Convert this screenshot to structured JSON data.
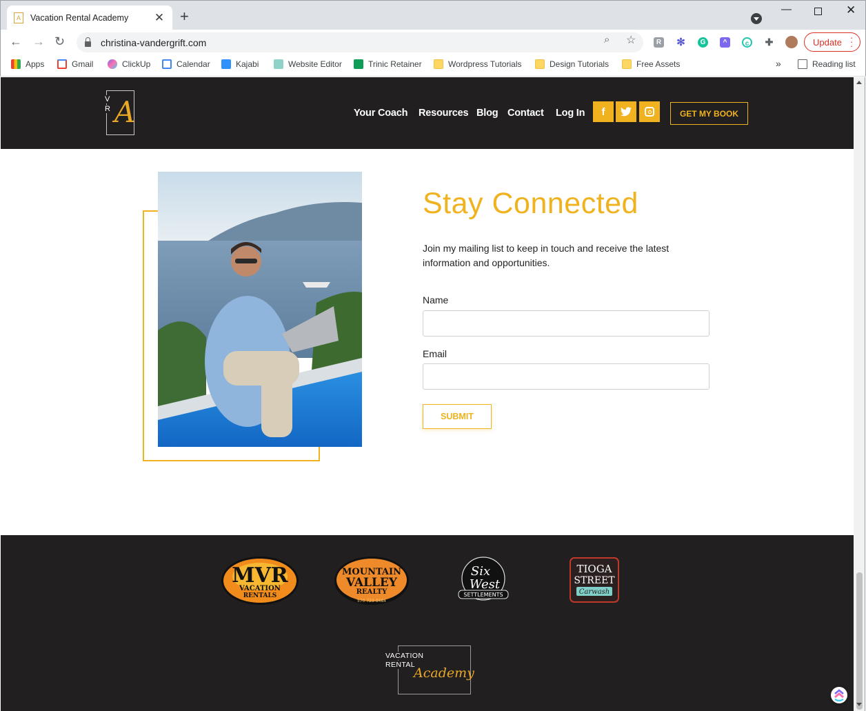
{
  "browser": {
    "tab_title": "Vacation Rental Academy",
    "tab_close": "✕",
    "new_tab": "+",
    "url": "christina-vandergrift.com",
    "update_label": "Update",
    "bookmarks": [
      {
        "label": "Apps",
        "icon": "apps-grid-icon"
      },
      {
        "label": "Gmail",
        "icon": "gmail-icon"
      },
      {
        "label": "ClickUp",
        "icon": "clickup-icon"
      },
      {
        "label": "Calendar",
        "icon": "calendar-icon"
      },
      {
        "label": "Kajabi",
        "icon": "kajabi-icon"
      },
      {
        "label": "Website Editor",
        "icon": "website-editor-icon"
      },
      {
        "label": "Trinic Retainer",
        "icon": "sheets-icon"
      },
      {
        "label": "Wordpress Tutorials",
        "icon": "folder-icon"
      },
      {
        "label": "Design Tutorials",
        "icon": "folder-icon"
      },
      {
        "label": "Free Assets",
        "icon": "folder-icon"
      }
    ],
    "bookmarks_overflow": "»",
    "reading_list": "Reading list"
  },
  "header": {
    "logo": {
      "v": "V",
      "r": "R",
      "a": "A"
    },
    "nav": [
      "Your Coach",
      "Resources",
      "Blog",
      "Contact",
      "Log In"
    ],
    "social": [
      {
        "icon": "facebook-icon",
        "glyph": "f"
      },
      {
        "icon": "twitter-icon",
        "glyph": "t"
      },
      {
        "icon": "instagram-icon",
        "glyph": "◎"
      }
    ],
    "cta": "GET MY BOOK"
  },
  "signup": {
    "title": "Stay Connected",
    "intro": "Join my mailing list to keep in touch and receive the latest information and opportunities.",
    "name_label": "Name",
    "name_value": "",
    "email_label": "Email",
    "email_value": "",
    "submit_label": "SUBMIT"
  },
  "footer": {
    "sponsors": [
      {
        "line1": "MVR",
        "line2": "VACATION",
        "line3": "RENTALS"
      },
      {
        "line1": "MOUNTAIN",
        "line2": "VALLEY",
        "line3": "REALTY",
        "line4": "570 723 8484"
      },
      {
        "line1": "Six",
        "line2": "West",
        "line3": "SETTLEMENTS"
      },
      {
        "line1": "TIOGA",
        "line2": "STREET",
        "line3": "Carwash"
      }
    ],
    "logo": {
      "line1": "VACATION",
      "line2": "RENTAL",
      "script": "Academy"
    }
  },
  "colors": {
    "accent": "#f0b21e",
    "dark": "#221f20"
  }
}
